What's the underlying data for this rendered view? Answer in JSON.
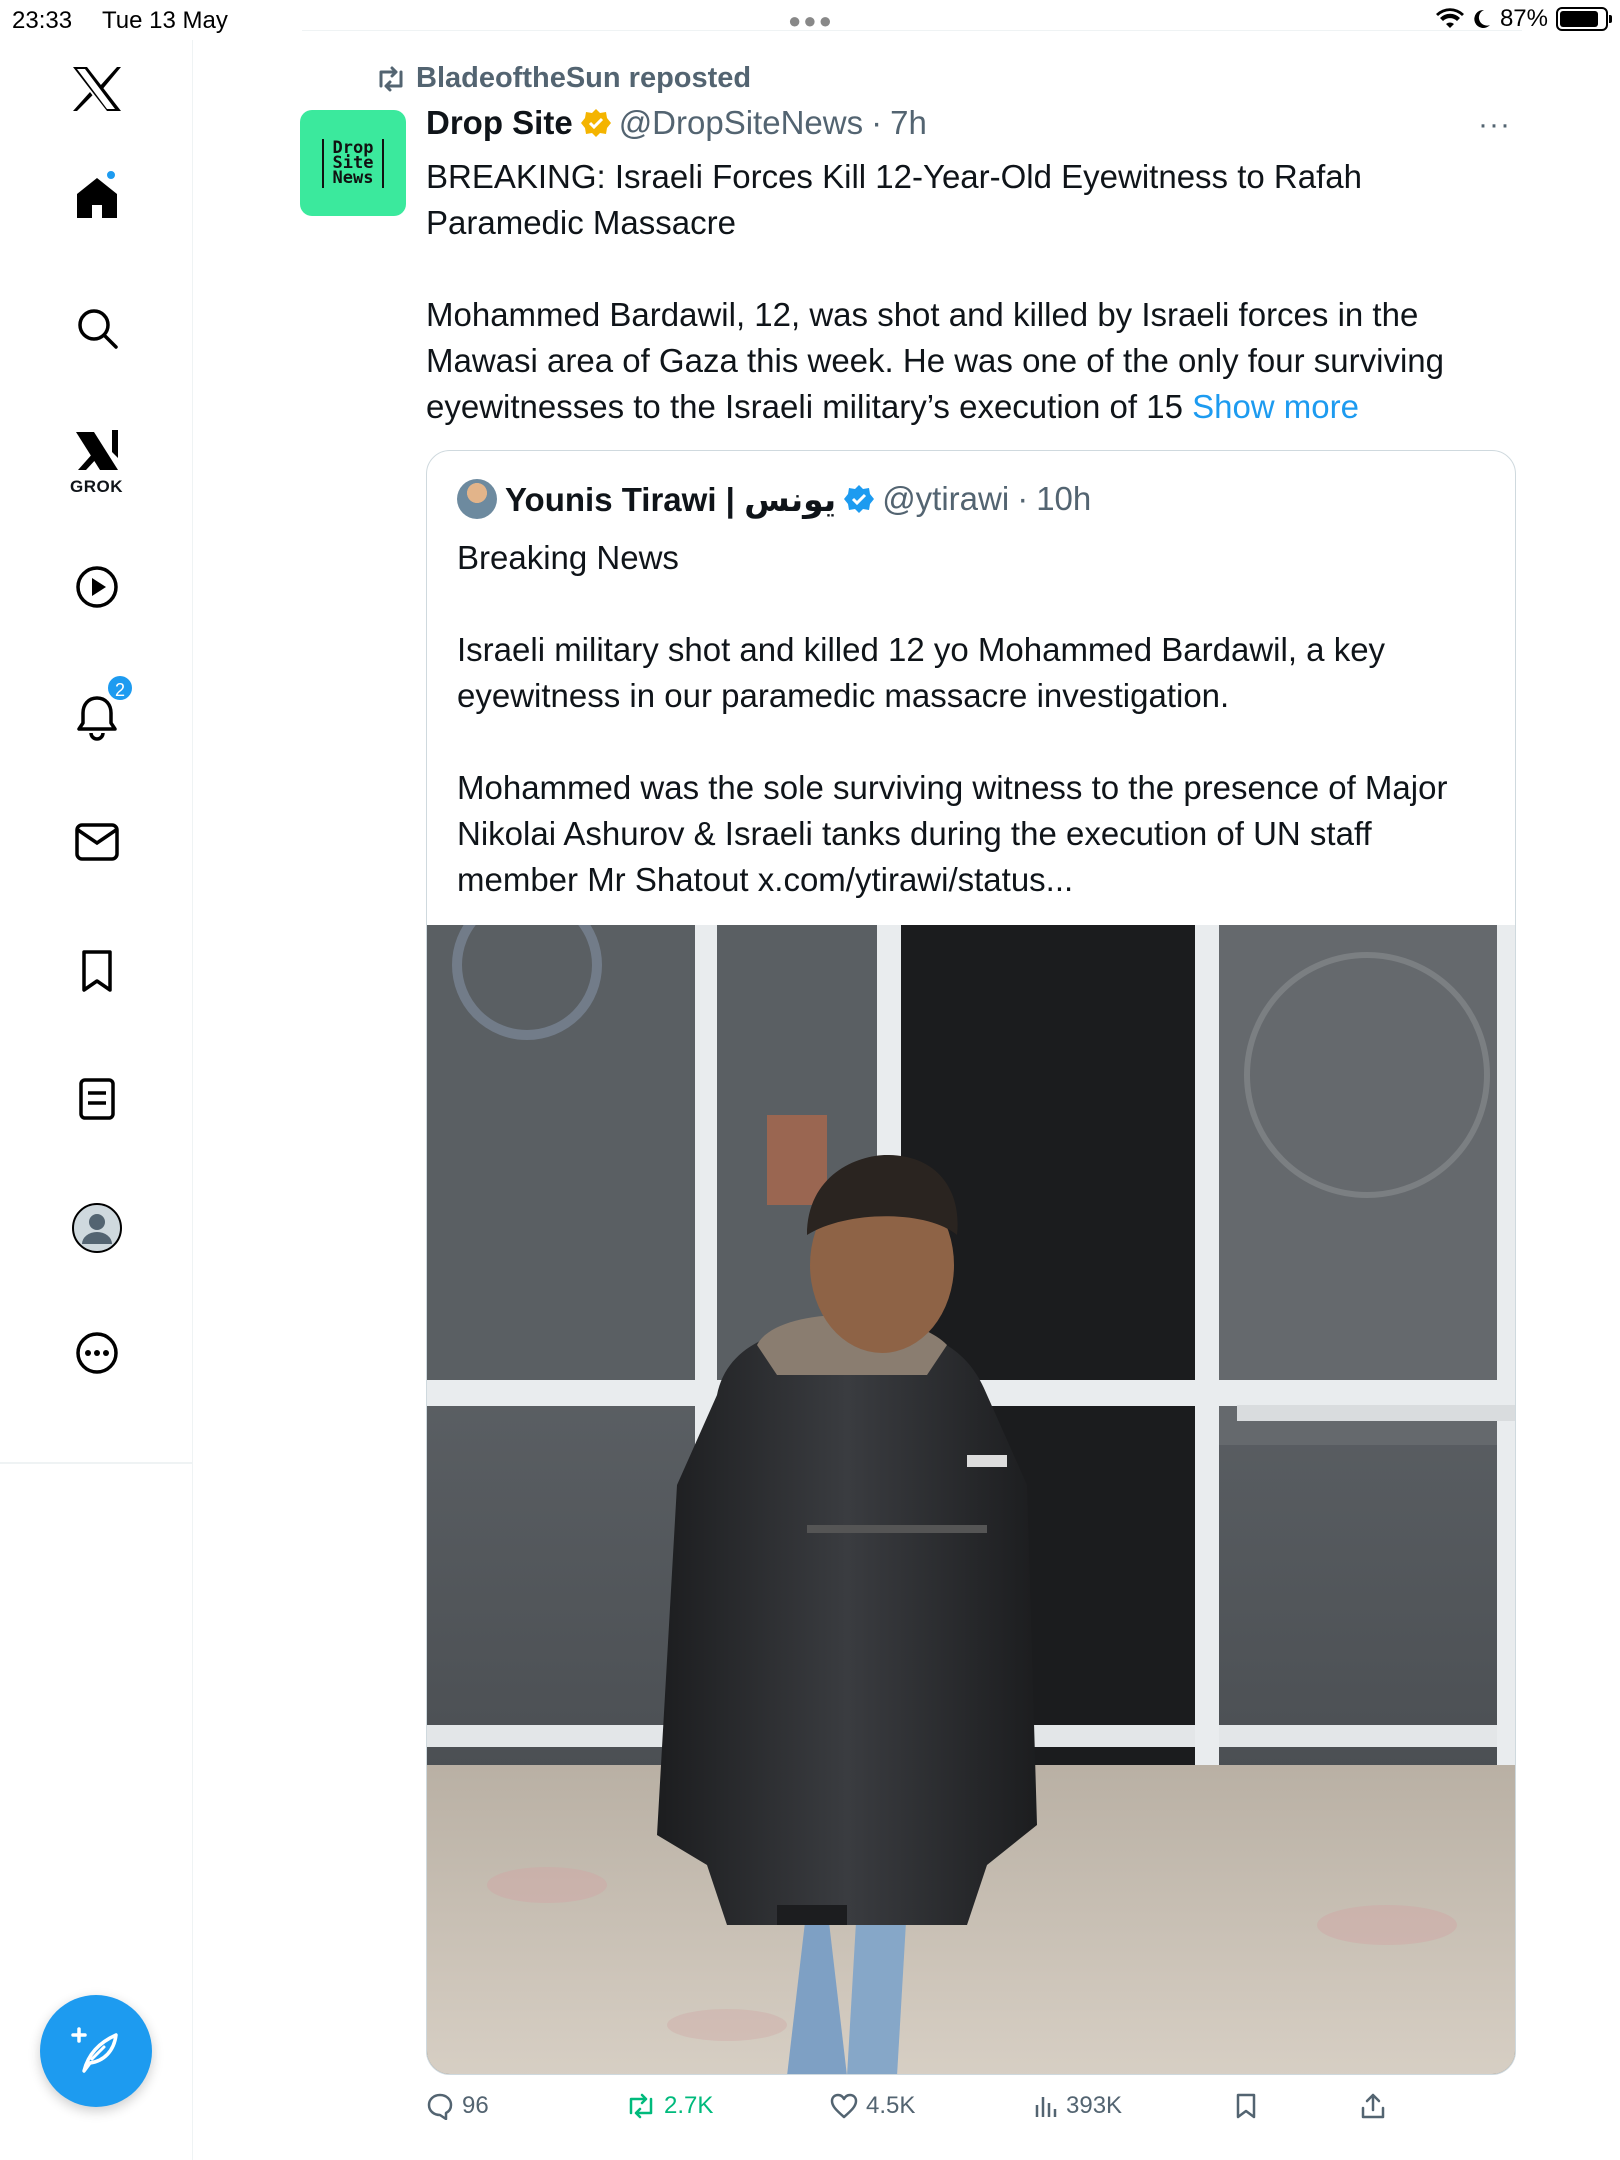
{
  "status_bar": {
    "time": "23:33",
    "date": "Tue 13 May",
    "battery": "87%"
  },
  "sidebar": {
    "items": [
      {
        "name": "logo",
        "icon": "x-logo-icon"
      },
      {
        "name": "home",
        "icon": "home-icon"
      },
      {
        "name": "explore",
        "icon": "search-icon"
      },
      {
        "name": "grok",
        "icon": "grok-icon",
        "label": "GROK"
      },
      {
        "name": "video",
        "icon": "play-icon"
      },
      {
        "name": "notifications",
        "icon": "bell-icon",
        "badge": "2"
      },
      {
        "name": "messages",
        "icon": "mail-icon"
      },
      {
        "name": "bookmarks",
        "icon": "bookmark-icon"
      },
      {
        "name": "lists",
        "icon": "list-icon"
      },
      {
        "name": "profile",
        "icon": "avatar-icon"
      },
      {
        "name": "more",
        "icon": "more-circle-icon"
      }
    ],
    "compose_icon": "compose-icon"
  },
  "post": {
    "repost_label": "BladeoftheSun reposted",
    "author_name": "Drop Site",
    "author_handle": "@DropSiteNews",
    "separator": "·",
    "time": "7h",
    "avatar_text": "Drop Site News",
    "paragraphs": [
      "BREAKING: Israeli Forces Kill 12-Year-Old Eyewitness to Rafah Paramedic Massacre",
      "Mohammed Bardawil, 12, was shot and killed by Israeli forces in the Mawasi area of Gaza this week. He was one of the only four surviving eyewitnesses to the Israeli military’s execution of 15"
    ],
    "show_more": "Show more",
    "quote": {
      "author_name": "Younis Tirawi | يونس",
      "author_handle": "@ytirawi",
      "separator": "·",
      "time": "10h",
      "paragraphs": [
        "Breaking News",
        "Israeli military shot and killed 12 yo Mohammed Bardawil, a key eyewitness in our paramedic massacre investigation.",
        "Mohammed was the sole surviving witness to the presence of Major Nikolai Ashurov & Israeli tanks during the execution of UN staff member Mr Shatout x.com/ytirawi/status..."
      ]
    },
    "actions": {
      "replies": "96",
      "reposts": "2.7K",
      "likes": "4.5K",
      "views": "393K"
    }
  },
  "colors": {
    "accent": "#1d9bf0",
    "repost_green": "#00ba7c",
    "secondary_text": "#536471",
    "drop_site_green": "#3be99d",
    "verified_gold": "#f4b400"
  }
}
